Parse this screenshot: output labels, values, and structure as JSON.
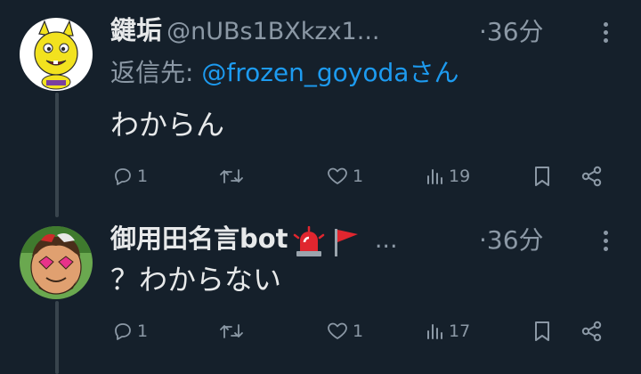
{
  "colors": {
    "background": "#15202b",
    "text_primary": "#e7e9ea",
    "text_secondary": "#8b98a5",
    "mention": "#1d9bf0",
    "thread_line": "#38444d"
  },
  "tweets": [
    {
      "display_name": "鍵垢",
      "handle": "@nUBs1BXkzx1...",
      "time": "·36分",
      "reply_label": "返信先: ",
      "reply_mention": "@frozen_goyoda",
      "reply_suffix": "さん",
      "text": "わからん",
      "avatar_icon": "yellow-cartoon-character-avatar",
      "actions": {
        "reply_count": "1",
        "retweet_count": "",
        "like_count": "1",
        "views_count": "19"
      }
    },
    {
      "display_name": "御用田名言bot",
      "badges": [
        "rotating-light-emoji",
        "red-flag-emoji"
      ],
      "name_overflow": "...",
      "time": "·36分",
      "text": "？わからない",
      "avatar_icon": "cartoon-man-avatar",
      "actions": {
        "reply_count": "1",
        "retweet_count": "",
        "like_count": "1",
        "views_count": "17"
      }
    }
  ],
  "icons": {
    "reply": "reply-icon",
    "retweet": "retweet-icon",
    "like": "heart-icon",
    "views": "views-bar-chart-icon",
    "bookmark": "bookmark-icon",
    "share": "share-icon",
    "more": "more-vertical-icon"
  }
}
